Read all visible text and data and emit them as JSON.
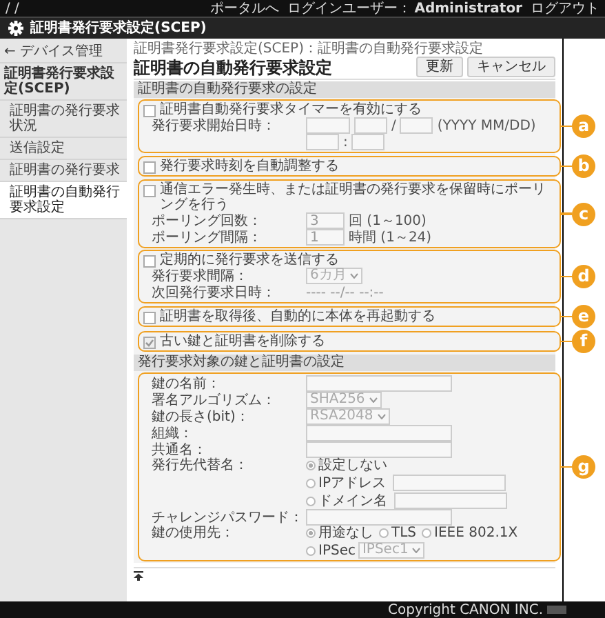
{
  "topbar": {
    "mark": "/ /",
    "portal_link": "ポータルへ",
    "user_label": "ログインユーザー：",
    "user": "Administrator",
    "logout_link": "ログアウト"
  },
  "header": {
    "title": "証明書発行要求設定(SCEP)"
  },
  "sidebar": {
    "back_link": "← デバイス管理",
    "group": "証明書発行要求設定(SCEP)",
    "items": [
      {
        "label": "証明書の発行要求状況",
        "selected": false
      },
      {
        "label": "送信設定",
        "selected": false
      },
      {
        "label": "証明書の発行要求",
        "selected": false
      },
      {
        "label": "証明書の自動発行要求設定",
        "selected": true
      }
    ]
  },
  "breadcrumb": "証明書発行要求設定(SCEP)：証明書の自動発行要求設定",
  "title": "証明書の自動発行要求設定",
  "buttons": [
    {
      "label": "更新"
    },
    {
      "label": "キャンセル"
    }
  ],
  "sections": [
    {
      "title": "証明書の自動発行要求の設定",
      "groups": [
        {
          "callout": "a",
          "rows": [
            {
              "kind": "checkbox",
              "label": "証明書自動発行要求タイマーを有効にする",
              "checked": false
            },
            {
              "kind": "date",
              "label": "発行要求開始日時：",
              "separator": "/",
              "format": "(YYYY MM/DD)"
            },
            {
              "kind": "time",
              "separator": ":"
            }
          ]
        },
        {
          "callout": "b",
          "rows": [
            {
              "kind": "checkbox",
              "label": "発行要求時刻を自動調整する",
              "checked": false
            }
          ]
        },
        {
          "callout": "c",
          "rows": [
            {
              "kind": "checkbox",
              "label": "通信エラー発生時、または証明書の発行要求を保留時にポーリングを行う",
              "checked": false
            },
            {
              "kind": "number",
              "label": "ポーリング回数：",
              "value": "3",
              "unit": "回 (1～100)"
            },
            {
              "kind": "number",
              "label": "ポーリング間隔：",
              "value": "1",
              "unit": "時間 (1～24)"
            }
          ]
        },
        {
          "callout": "d",
          "rows": [
            {
              "kind": "checkbox",
              "label": "定期的に発行要求を送信する",
              "checked": false
            },
            {
              "kind": "select",
              "label": "発行要求間隔：",
              "value": "6カ月"
            },
            {
              "kind": "reading",
              "label": "次回発行要求日時：",
              "value": "---- --/-- --:--"
            }
          ]
        },
        {
          "callout": "e",
          "rows": [
            {
              "kind": "checkbox",
              "label": "証明書を取得後、自動的に本体を再起動する",
              "checked": false
            }
          ]
        },
        {
          "callout": "f",
          "rows": [
            {
              "kind": "checkbox",
              "label": "古い鍵と証明書を削除する",
              "checked": true
            }
          ]
        }
      ]
    },
    {
      "title": "発行要求対象の鍵と証明書の設定",
      "groups": [
        {
          "callout": "g",
          "rows": [
            {
              "kind": "field",
              "label": "鍵の名前："
            },
            {
              "kind": "select",
              "label": "署名アルゴリズム：",
              "value": "SHA256"
            },
            {
              "kind": "select",
              "label": "鍵の長さ(bit)：",
              "value": "RSA2048"
            },
            {
              "kind": "field",
              "label": "組織："
            },
            {
              "kind": "field",
              "label": "共通名："
            },
            {
              "kind": "radios",
              "label": "発行先代替名：",
              "options": [
                {
                  "label": "設定しない",
                  "selected": true
                },
                {
                  "label": "IPアドレス",
                  "selected": false,
                  "field": true
                },
                {
                  "label": "ドメイン名",
                  "selected": false,
                  "field": true
                }
              ]
            },
            {
              "kind": "field",
              "label": "チャレンジパスワード："
            },
            {
              "kind": "radios",
              "label": "鍵の使用先：",
              "options": [
                {
                  "label": "用途なし",
                  "selected": true
                },
                {
                  "label": "TLS",
                  "selected": false
                },
                {
                  "label": "IEEE 802.1X",
                  "selected": false
                },
                {
                  "label": "IPSec",
                  "selected": false,
                  "select": "IPSec1"
                }
              ]
            }
          ]
        }
      ]
    }
  ],
  "copyright": "Copyright CANON INC."
}
